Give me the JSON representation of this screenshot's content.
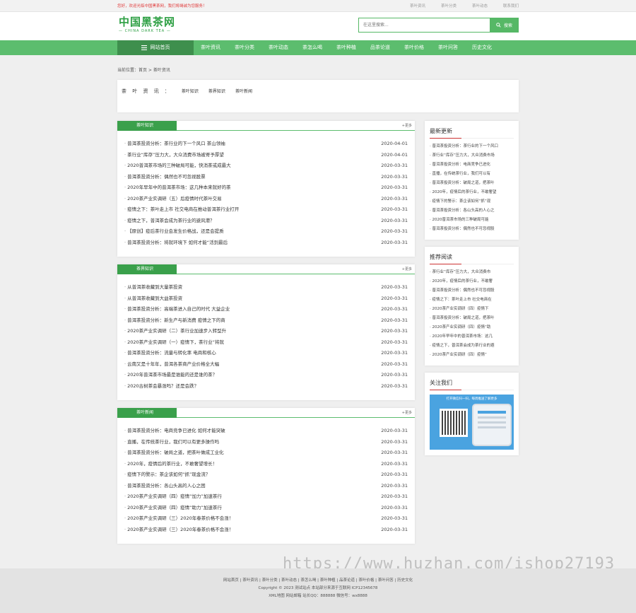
{
  "topbar": {
    "notice": "您好，欢迎光临中国黑茶网，我们将竭诚为您服务！",
    "links": [
      "茶叶资讯",
      "茶叶分类",
      "茶叶动态",
      "联系我们"
    ]
  },
  "header": {
    "logo_cn": "中国黑茶网",
    "logo_en": "— CHINA DARK TEA —",
    "search_placeholder": "在这里搜索...",
    "search_button": "搜索"
  },
  "nav": {
    "home": "网站首页",
    "items": [
      "茶叶资讯",
      "茶叶分类",
      "茶叶动态",
      "茶怎么喝",
      "茶叶种植",
      "品茶论道",
      "茶叶价格",
      "茶叶问答",
      "历史文化"
    ]
  },
  "breadcrumb": "当前位置：首页 > 茶叶资讯",
  "category_box": {
    "label": "茶 叶 资 讯 ：",
    "links": [
      "茶叶知识",
      "茶界知识",
      "茶叶新闻"
    ]
  },
  "panels": [
    {
      "title": "茶叶知识",
      "more": "+更多",
      "items": [
        {
          "title": "普洱茶投资分析：茶行业的下一个风口 茶山领袖",
          "date": "2020-04-01"
        },
        {
          "title": "茶行业“库存”压力大，大众消费市场被寄予厚望",
          "date": "2020-04-01"
        },
        {
          "title": "2020普洱茶市场的三种破局可能，快消茶或成最大",
          "date": "2020-03-31"
        },
        {
          "title": "普洱茶投资分析：偶然也不可忽视股票",
          "date": "2020-03-31"
        },
        {
          "title": "2020年早年中的普洱茶市场：这几种本来就好的茶",
          "date": "2020-03-31"
        },
        {
          "title": "2020茶产业实调研（五）后疫情时代茶叶交易",
          "date": "2020-03-31"
        },
        {
          "title": "疫情之下：茶叶走上市 社交电商在推动普洱茶行业打开",
          "date": "2020-03-31"
        },
        {
          "title": "疫情之下，普洱茶会成为茶行业的避风港？",
          "date": "2020-03-31"
        },
        {
          "title": "【原创】疫后茶行业会发生价格战，还是会提质",
          "date": "2020-03-31"
        },
        {
          "title": "普洱茶投资分析：将就环境下 如何才能“活到最后",
          "date": "2020-03-31"
        }
      ]
    },
    {
      "title": "茶界知识",
      "more": "+更多",
      "items": [
        {
          "title": "从普洱茶收藏到大量茶投资",
          "date": "2020-03-31"
        },
        {
          "title": "从普洱茶收藏到大益茶投资",
          "date": "2020-03-31"
        },
        {
          "title": "普洱茶投资分析：高端茶进入自己的时代 大益企业",
          "date": "2020-03-31"
        },
        {
          "title": "普洱茶投资分析：新生产与新消费 疫情之下的商",
          "date": "2020-03-31"
        },
        {
          "title": "2020茶产业实调研（二）茶行业加速步入转型升",
          "date": "2020-03-31"
        },
        {
          "title": "2020茶产业实调研（一）疫情下，茶行业“将就",
          "date": "2020-03-31"
        },
        {
          "title": "普洱茶投资分析：流量与转化率 电商和核心",
          "date": "2020-03-31"
        },
        {
          "title": "云南又是十年年，普洱各茶商产业价格全大幅",
          "date": "2020-03-31"
        },
        {
          "title": "2020年普洱茶市场最是谁能的还是谁的茶？",
          "date": "2020-03-31"
        },
        {
          "title": "2020古树茶会暴涨吗？还是会跌？",
          "date": "2020-03-31"
        }
      ]
    },
    {
      "title": "茶叶新闻",
      "more": "+更多",
      "items": [
        {
          "title": "普洱茶投资分析：电商竞争已进化 如何才能突破",
          "date": "2020-03-31"
        },
        {
          "title": "直播，在传统茶行业，我们可以有更多操作吗",
          "date": "2020-03-31"
        },
        {
          "title": "普洱茶投资分析：破局之道，把茶叶做成工业化",
          "date": "2020-03-31"
        },
        {
          "title": "2020年，疫情后的茶行业，不敢奢望增长！",
          "date": "2020-03-31"
        },
        {
          "title": "疫情下的警示：茶企该如何“抓”现金流？",
          "date": "2020-03-31"
        },
        {
          "title": "普洱茶投资分析：各山头高的人心之困",
          "date": "2020-03-31"
        },
        {
          "title": "2020茶产业实调研（四）疫情“加力”加速茶行",
          "date": "2020-03-31"
        },
        {
          "title": "2020茶产业实调研（四）疫情“助力”加速茶行",
          "date": "2020-03-31"
        },
        {
          "title": "2020茶产业实调研（三）2020年春茶价格不会涨！",
          "date": "2020-03-31"
        },
        {
          "title": "2020茶产业实调研（三）2020年春茶价格不会涨！",
          "date": "2020-03-31"
        }
      ]
    }
  ],
  "sidebar": {
    "latest": {
      "title": "最新更新",
      "items": [
        "普洱茶投资分析：茶行业的下一个风口",
        "茶行业“库存”压力大，大众消费市场",
        "普洱茶投资分析：电商竞争已进化",
        "直播，在传统茶行业，我们可以有",
        "普洱茶投资分析：破局之道，把茶叶",
        "2020年，疫情后的茶行业，不敢奢望",
        "疫情下的警示：茶企该如何“抓”现",
        "普洱茶投资分析：各山头高的人心之",
        "2020普洱茶市场的三种破局可能",
        "普洱茶投资分析：偶然也不可忽视股"
      ]
    },
    "recommend": {
      "title": "推荐阅读",
      "items": [
        "茶行业“库存”压力大，大众消费市",
        "2020年，疫情后的茶行业，不敢奢",
        "普洱茶投资分析：偶然也不可忽视股",
        "疫情之下：茶叶走上市 社交电商在",
        "2020茶产业实调研（四）疫情下",
        "普洱茶投资分析：破局之道，把茶叶",
        "2020茶产业实调研（四）疫情“助",
        "2020年早年中的普洱茶市场：这几",
        "疫情之下，普洱茶会成为茶行业的避",
        "2020茶产业实调研（四）疫情“"
      ]
    },
    "follow": {
      "title": "关注我们",
      "caption": "打开微信扫一扫，每周推送了解更多"
    }
  },
  "footer": {
    "links": "网站首页 | 茶叶资讯 | 茶叶分类 | 茶叶动态 | 茶怎么喝 | 茶叶种植 | 品茶论道 | 茶叶价格 | 茶叶问答 | 历史文化",
    "copyright": "Copyright © 2023 测试站点 本站部分来源于互联网 ICP12345678",
    "contact": "XML地图 网站邮箱 站长QQ：888888 微信号：wx8888"
  },
  "watermark": "https://www.huzhan.com/ishop27193"
}
